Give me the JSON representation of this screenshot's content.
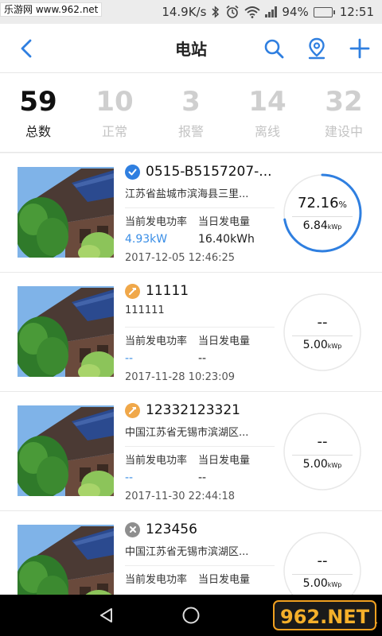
{
  "status_bar": {
    "watermark": "乐游网 www.962.net",
    "speed": "14.9K/s",
    "battery_pct": "94%",
    "battery_level": 0.94,
    "time": "12:51"
  },
  "header": {
    "title": "电站",
    "icons": [
      "back-icon",
      "search-icon",
      "location-pin-icon",
      "plus-icon"
    ],
    "accent": "#2f7fe0"
  },
  "summary": [
    {
      "value": "59",
      "label": "总数"
    },
    {
      "value": "10",
      "label": "正常"
    },
    {
      "value": "3",
      "label": "报警"
    },
    {
      "value": "14",
      "label": "离线"
    },
    {
      "value": "32",
      "label": "建设中"
    }
  ],
  "stations": [
    {
      "status": "normal",
      "status_color": "#2f7fe0",
      "name": "0515-B5157207-...",
      "address": "江苏省盐城市滨海县三里...",
      "power_label": "当前发电功率",
      "energy_label": "当日发电量",
      "power": "4.93kW",
      "energy": "16.40kWh",
      "time": "2017-12-05 12:46:25",
      "ratio": "72.16",
      "ratio_unit": "%",
      "ratio_value": 72.16,
      "capacity": "6.84",
      "capacity_unit": "kWp"
    },
    {
      "status": "building",
      "status_color": "#f0a84a",
      "name": "11111",
      "address": "111111",
      "power_label": "当前发电功率",
      "energy_label": "当日发电量",
      "power": "--",
      "energy": "--",
      "time": "2017-11-28 10:23:09",
      "ratio": "--",
      "ratio_unit": "",
      "ratio_value": 0,
      "capacity": "5.00",
      "capacity_unit": "kWp"
    },
    {
      "status": "building",
      "status_color": "#f0a84a",
      "name": "12332123321",
      "address": "中国江苏省无锡市滨湖区...",
      "power_label": "当前发电功率",
      "energy_label": "当日发电量",
      "power": "--",
      "energy": "--",
      "time": "2017-11-30 22:44:18",
      "ratio": "--",
      "ratio_unit": "",
      "ratio_value": 0,
      "capacity": "5.00",
      "capacity_unit": "kWp"
    },
    {
      "status": "offline",
      "status_color": "#8e8e8e",
      "name": "123456",
      "address": "中国江苏省无锡市滨湖区...",
      "power_label": "当前发电功率",
      "energy_label": "当日发电量",
      "power": "--",
      "energy": "--",
      "time": "",
      "ratio": "--",
      "ratio_unit": "",
      "ratio_value": 0,
      "capacity": "5.00",
      "capacity_unit": "kWp"
    }
  ],
  "nav": {
    "icons": [
      "back-triangle-icon",
      "home-circle-icon"
    ],
    "watermark": "962.NET 乐游网"
  }
}
